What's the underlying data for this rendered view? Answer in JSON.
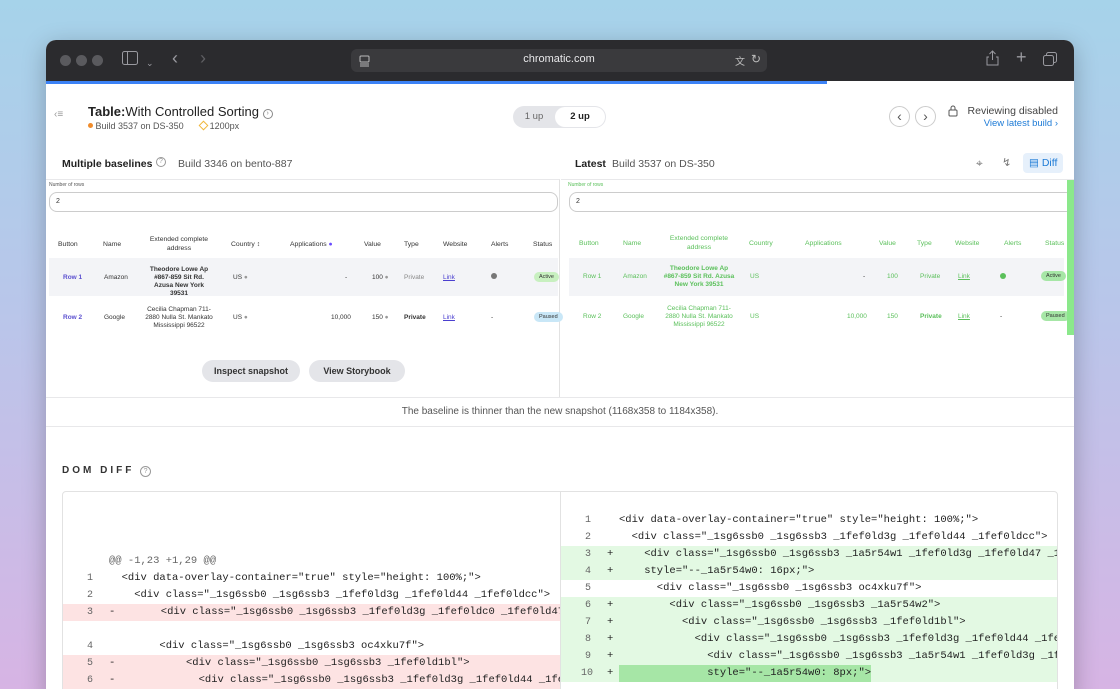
{
  "browser": {
    "url": "chromatic.com"
  },
  "header": {
    "title_bold": "Table",
    "title_rest": "With Controlled Sorting",
    "build": "Build 3537 on DS-350",
    "viewport": "1200px",
    "toggle": [
      "1 up",
      "2 up"
    ],
    "review_status": "Reviewing disabled",
    "view_latest": "View latest build"
  },
  "baseline": {
    "title": "Multiple baselines",
    "build": "Build 3346 on bento-887"
  },
  "latest": {
    "title": "Latest",
    "build": "Build 3537 on DS-350",
    "diff_label": "Diff"
  },
  "table": {
    "rows_label": "Number of rows",
    "rows_value": "2",
    "headers": [
      "Button",
      "Name",
      "Extended complete address",
      "Country",
      "Applications",
      "Value",
      "Type",
      "Website",
      "Alerts",
      "Status"
    ],
    "rows": [
      {
        "button": "Row 1",
        "name": "Amazon",
        "address": "Theodore Lowe Ap #867-859 Sit Rd. Azusa New York 39531",
        "country": "US",
        "applications": "-",
        "value": "100",
        "type": "Private",
        "website": "Link",
        "alerts": "",
        "status": "Active"
      },
      {
        "button": "Row 2",
        "name": "Google",
        "address": "Cecilia Chapman 711-2880 Nulla St. Mankato Mississippi 96522",
        "country": "US",
        "applications": "10,000",
        "value": "150",
        "type": "Private",
        "website": "Link",
        "alerts": "-",
        "status": "Paused"
      }
    ]
  },
  "actions": {
    "inspect": "Inspect snapshot",
    "storybook": "View Storybook"
  },
  "note": "The baseline is thinner than the new snapshot (1168x358 to 1184x358).",
  "dom_diff": {
    "title": "DOM DIFF",
    "hunk": "@@ -1,23 +1,29 @@",
    "left": [
      {
        "n": "1",
        "m": "",
        "t": "  <div data-overlay-container=\"true\" style=\"height: 100%;\">",
        "k": ""
      },
      {
        "n": "2",
        "m": "",
        "t": "    <div class=\"_1sg6ssb0 _1sg6ssb3 _1fef0ld3g _1fef0ld44 _1fef0ldcc\">",
        "k": ""
      },
      {
        "n": "3",
        "m": "-",
        "t": "      <div class=\"_1sg6ssb0 _1sg6ssb3 _1fef0ld3g _1fef0ldc0 _1fef0ld47 _1fe",
        "k": "r"
      },
      {
        "n": "4",
        "m": "",
        "t": "        <div class=\"_1sg6ssb0 _1sg6ssb3 oc4xku7f\">",
        "k": ""
      },
      {
        "n": "5",
        "m": "-",
        "t": "          <div class=\"_1sg6ssb0 _1sg6ssb3 _1fef0ld1bl\">",
        "k": "r"
      },
      {
        "n": "6",
        "m": "-",
        "t": "            <div class=\"_1sg6ssb0 _1sg6ssb3 _1fef0ld3g _1fef0ld44 _1fef0ld",
        "k": "r"
      }
    ],
    "right": [
      {
        "n": "1",
        "m": "",
        "t": "<div data-overlay-container=\"true\" style=\"height: 100%;\">",
        "k": ""
      },
      {
        "n": "2",
        "m": "",
        "t": "  <div class=\"_1sg6ssb0 _1sg6ssb3 _1fef0ld3g _1fef0ld44 _1fef0ldcc\">",
        "k": ""
      },
      {
        "n": "3",
        "m": "+",
        "t": "    <div class=\"_1sg6ssb0 _1sg6ssb3 _1a5r54w1 _1fef0ld3g _1fef0ld47 _1fef",
        "k": "g"
      },
      {
        "n": "4",
        "m": "+",
        "t": "    style=\"--_1a5r54w0: 16px;\">",
        "k": "g"
      },
      {
        "n": "5",
        "m": "",
        "t": "      <div class=\"_1sg6ssb0 _1sg6ssb3 oc4xku7f\">",
        "k": ""
      },
      {
        "n": "6",
        "m": "+",
        "t": "        <div class=\"_1sg6ssb0 _1sg6ssb3 _1a5r54w2\">",
        "k": "g"
      },
      {
        "n": "7",
        "m": "+",
        "t": "          <div class=\"_1sg6ssb0 _1sg6ssb3 _1fef0ld1bl\">",
        "k": "g"
      },
      {
        "n": "8",
        "m": "+",
        "t": "            <div class=\"_1sg6ssb0 _1sg6ssb3 _1fef0ld3g _1fef0ld44 _1fef0",
        "k": "g"
      },
      {
        "n": "9",
        "m": "+",
        "t": "              <div class=\"_1sg6ssb0 _1sg6ssb3 _1a5r54w1 _1fef0ld3g _1fef",
        "k": "g"
      },
      {
        "n": "10",
        "m": "+",
        "t": "              style=\"--_1a5r54w0: 8px;\">",
        "k": "g"
      }
    ]
  },
  "colors": {
    "accent": "#1e7bd6",
    "progress": "#3b82f6",
    "removed": "#fde3e3",
    "added": "#e3f9e3",
    "active": "#c8f0c0",
    "paused": "#c9e7f7"
  }
}
